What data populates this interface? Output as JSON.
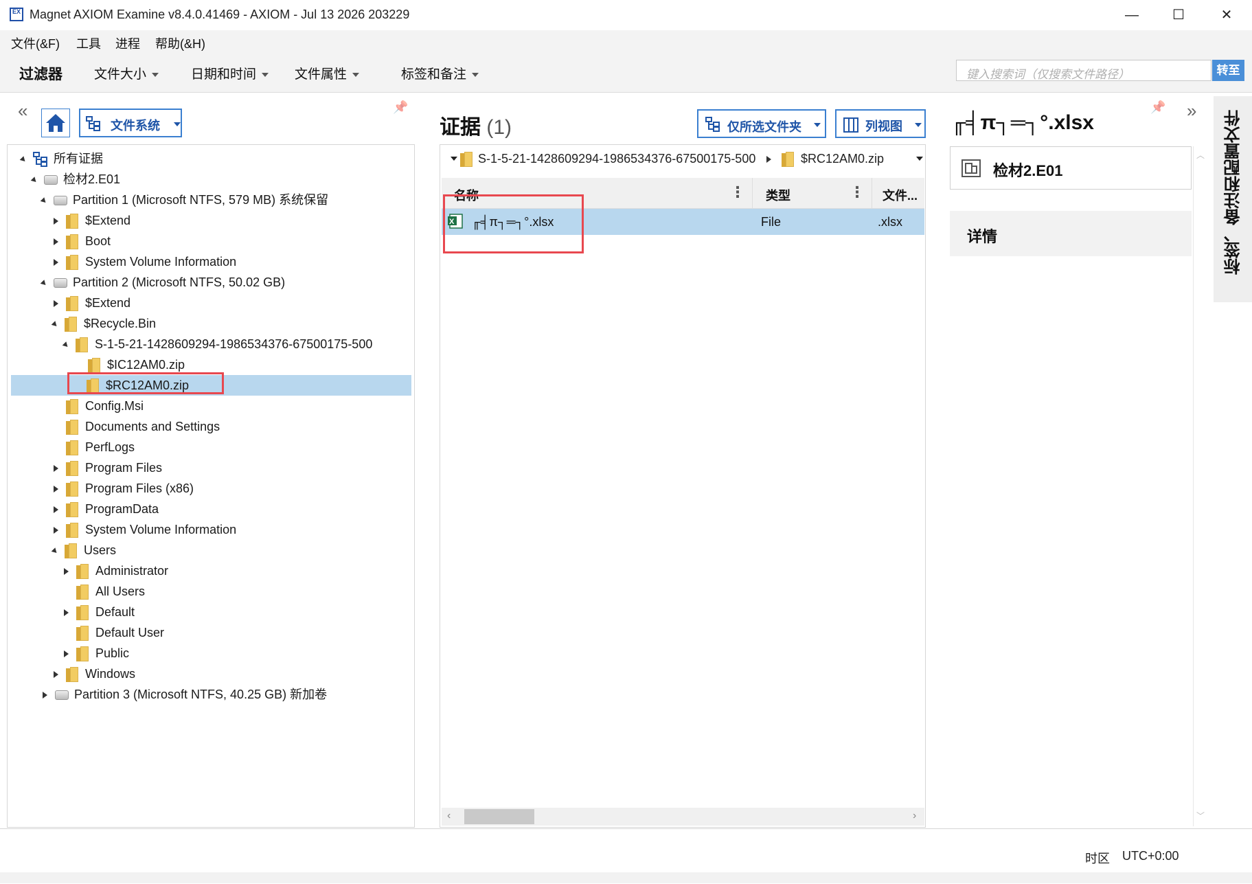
{
  "window": {
    "title": "Magnet AXIOM Examine v8.4.0.41469 - AXIOM - Jul 13 2026 203229",
    "icon_text": "EX",
    "controls": {
      "minimize": "—",
      "maximize": "☐",
      "close": "✕"
    }
  },
  "menu": [
    "文件(&F)",
    "工具",
    "进程",
    "帮助(&H)"
  ],
  "filters": {
    "label": "过滤器",
    "items": [
      "文件大小",
      "日期和时间",
      "文件属性",
      "标签和备注"
    ],
    "search_placeholder": "键入搜索词（仅搜索文件路径）",
    "goto_label": "转至"
  },
  "left_panel": {
    "collapse_icon": "«",
    "pin_icon": "📌",
    "view_button": "文件系统",
    "tree": [
      {
        "label": "所有证据",
        "expander": "down",
        "icon": "tree-root"
      },
      {
        "label": "检材2.E01",
        "expander": "down",
        "icon": "drive"
      },
      {
        "label": "Partition 1 (Microsoft NTFS, 579 MB) 系统保留",
        "expander": "down",
        "icon": "drive"
      },
      {
        "label": "$Extend",
        "expander": "right",
        "icon": "folder"
      },
      {
        "label": "Boot",
        "expander": "right",
        "icon": "folder"
      },
      {
        "label": "System Volume Information",
        "expander": "right",
        "icon": "folder"
      },
      {
        "label": "Partition 2 (Microsoft NTFS, 50.02 GB)",
        "expander": "down",
        "icon": "drive"
      },
      {
        "label": "$Extend",
        "expander": "right",
        "icon": "folder"
      },
      {
        "label": "$Recycle.Bin",
        "expander": "down",
        "icon": "folder"
      },
      {
        "label": "S-1-5-21-1428609294-1986534376-67500175-500",
        "expander": "down",
        "icon": "folder"
      },
      {
        "label": "$IC12AM0.zip",
        "expander": "none",
        "icon": "folder"
      },
      {
        "label": "$RC12AM0.zip",
        "expander": "none",
        "icon": "folder",
        "selected": true
      },
      {
        "label": "Config.Msi",
        "expander": "none",
        "icon": "folder"
      },
      {
        "label": "Documents and Settings",
        "expander": "none",
        "icon": "folder"
      },
      {
        "label": "PerfLogs",
        "expander": "none",
        "icon": "folder"
      },
      {
        "label": "Program Files",
        "expander": "right",
        "icon": "folder"
      },
      {
        "label": "Program Files (x86)",
        "expander": "right",
        "icon": "folder"
      },
      {
        "label": "ProgramData",
        "expander": "right",
        "icon": "folder"
      },
      {
        "label": "System Volume Information",
        "expander": "right",
        "icon": "folder"
      },
      {
        "label": "Users",
        "expander": "down",
        "icon": "folder"
      },
      {
        "label": "Administrator",
        "expander": "right",
        "icon": "folder"
      },
      {
        "label": "All Users",
        "expander": "none",
        "icon": "folder"
      },
      {
        "label": "Default",
        "expander": "right",
        "icon": "folder"
      },
      {
        "label": "Default User",
        "expander": "none",
        "icon": "folder"
      },
      {
        "label": "Public",
        "expander": "right",
        "icon": "folder"
      },
      {
        "label": "Windows",
        "expander": "right",
        "icon": "folder"
      },
      {
        "label": "Partition 3 (Microsoft NTFS, 40.25 GB) 新加卷",
        "expander": "right",
        "icon": "drive"
      }
    ]
  },
  "middle_panel": {
    "title": "证据",
    "count": "(1)",
    "folder_filter_button": "仅所选文件夹",
    "view_button": "列视图",
    "breadcrumb": [
      "S-1-5-21-1428609294-1986534376-67500175-500",
      "$RC12AM0.zip"
    ],
    "columns": [
      "名称",
      "类型",
      "文件..."
    ],
    "rows": [
      {
        "name": "╓╡π┐═┐°.xlsx",
        "type": "File",
        "ext": ".xlsx"
      }
    ]
  },
  "right_panel": {
    "title": "╓╡π┐═┐°.xlsx",
    "evidence_source": "检材2.E01",
    "details_label": "详情",
    "side_tab": "标签、备注和配置文件",
    "expand_icon": "»"
  },
  "status": {
    "tz_label": "时区",
    "tz_value": "UTC+0:00"
  },
  "colors": {
    "accent": "#3a7fd0",
    "selection": "#b8d7ee",
    "highlight_box": "#e8484f"
  }
}
